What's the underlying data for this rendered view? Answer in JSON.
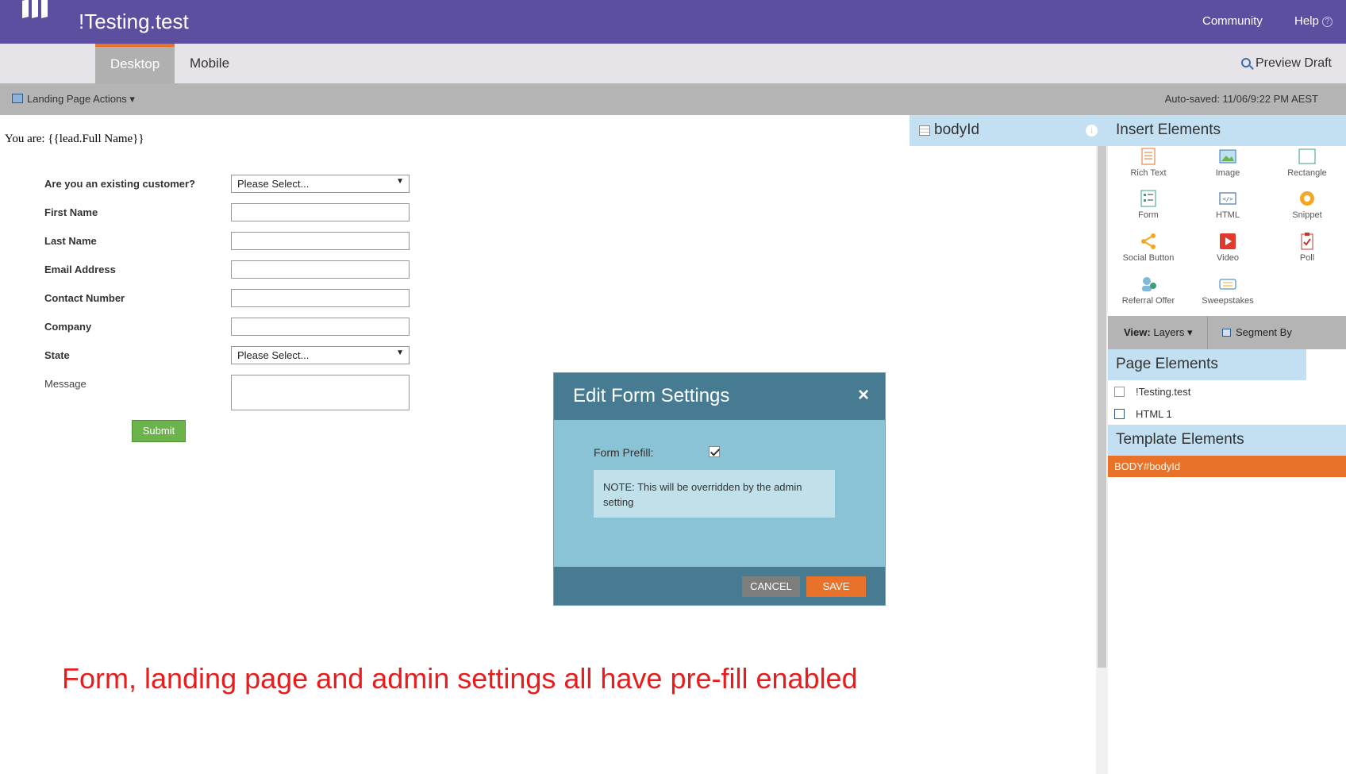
{
  "app": {
    "title": "!Testing.test"
  },
  "header": {
    "community": "Community",
    "help": "Help",
    "help_icon": "question-circle-icon"
  },
  "tabs": {
    "desktop": "Desktop",
    "mobile": "Mobile",
    "preview": "Preview Draft"
  },
  "actions": {
    "landing_page_actions": "Landing Page Actions ▾",
    "autosaved": "Auto-saved: 11/06/9:22 PM AEST"
  },
  "canvas": {
    "you_are": "You are: {{lead.Full Name}}",
    "form": {
      "fields": [
        {
          "label": "Are you an existing customer?",
          "value": "Please Select..."
        },
        {
          "label": "First Name",
          "value": ""
        },
        {
          "label": "Last Name",
          "value": ""
        },
        {
          "label": "Email Address",
          "value": ""
        },
        {
          "label": "Contact Number",
          "value": ""
        },
        {
          "label": "Company",
          "value": ""
        },
        {
          "label": "State",
          "value": "Please Select..."
        },
        {
          "label": "Message",
          "value": ""
        }
      ],
      "submit": "Submit"
    },
    "caption": "Form, landing page and admin settings all have pre-fill enabled"
  },
  "panel": {
    "bodyid": "bodyId",
    "insert_title": "Insert Elements",
    "insert_items": [
      {
        "label": "Rich Text",
        "icon": "rich-text-icon"
      },
      {
        "label": "Image",
        "icon": "image-icon"
      },
      {
        "label": "Rectangle",
        "icon": "rectangle-icon"
      },
      {
        "label": "Form",
        "icon": "form-icon"
      },
      {
        "label": "HTML",
        "icon": "html-icon"
      },
      {
        "label": "Snippet",
        "icon": "snippet-icon"
      },
      {
        "label": "Social Button",
        "icon": "social-button-icon"
      },
      {
        "label": "Video",
        "icon": "video-icon"
      },
      {
        "label": "Poll",
        "icon": "poll-icon"
      },
      {
        "label": "Referral Offer",
        "icon": "referral-offer-icon"
      },
      {
        "label": "Sweepstakes",
        "icon": "sweepstakes-icon"
      }
    ],
    "view_label": "View:",
    "view_value": "Layers ▾",
    "segment_by": "Segment By",
    "page_elements_title": "Page Elements",
    "page_elements": [
      "!Testing.test",
      "HTML 1"
    ],
    "template_elements_title": "Template Elements",
    "template_elements": [
      "BODY#bodyId"
    ]
  },
  "modal": {
    "title": "Edit Form Settings",
    "close": "×",
    "prefill_label": "Form Prefill:",
    "prefill_checked": true,
    "note": "NOTE: This will be overridden by the admin setting",
    "cancel": "CANCEL",
    "save": "SAVE"
  },
  "colors": {
    "brand": "#5c4f9f",
    "accent": "#e8722a",
    "submit": "#6cb34b",
    "modal_header": "#467b91",
    "modal_body": "#8ac2d6",
    "caption": "#e81c1c"
  }
}
